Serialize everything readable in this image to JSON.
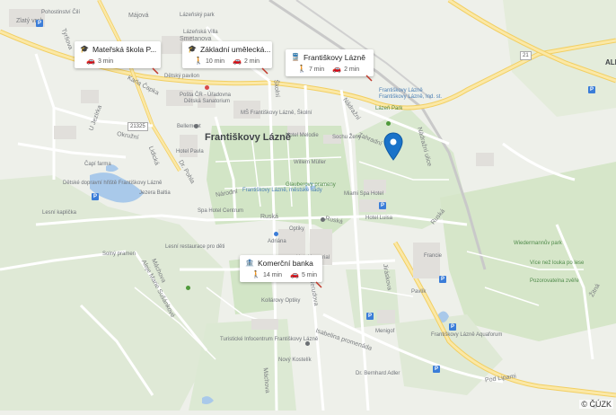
{
  "map": {
    "town_label": "Františkovy Lázně",
    "streets": [
      "Májová",
      "Karla Čapka",
      "Okružní",
      "Lidická",
      "Dr. Pohla",
      "Ruská",
      "Ruská",
      "Ruská",
      "Jiráskova",
      "Nádražní",
      "Zahradní",
      "Nádražní ulice",
      "Máchova",
      "Máchova",
      "Aleje Marie Sušánkové",
      "Isabelina promenáda",
      "Nerudova",
      "Národní",
      "Pod Lipami",
      "Školní",
      "Žitná",
      "U Jezírka",
      "Tyršova",
      "Zlatý vrch",
      "Smetanova"
    ],
    "road_shields": [
      "21325",
      "21"
    ],
    "places": [
      {
        "text": "Pohostinství Čilí"
      },
      {
        "text": "Lázeňský park"
      },
      {
        "text": "Lázeňská Villa"
      },
      {
        "text": "Dětský pavilon"
      },
      {
        "text": "Pošta ČR - Úřadovna"
      },
      {
        "text": "Dětská Sanatorium"
      },
      {
        "text": "Františkovy Lázně"
      },
      {
        "text": "MŠ Františkovy Lázně, Školní"
      },
      {
        "text": "Bellemont"
      },
      {
        "text": "Hotel Melodie"
      },
      {
        "text": "Sochu Ženy"
      },
      {
        "text": "Lázeň Park"
      },
      {
        "text": "Čapí farma"
      },
      {
        "text": "Dětské dopravní hřiště Františkovy Lázně"
      },
      {
        "text": "Hotel Pavla"
      },
      {
        "text": "Spa Hotel Centrum"
      },
      {
        "text": "Františkovy Lázně, městské sady"
      },
      {
        "text": "Willem Müller"
      },
      {
        "text": "Glauberovy prameny"
      },
      {
        "text": "Miami Spa Hotel"
      },
      {
        "text": "Hotel Luisa"
      },
      {
        "text": "Lesní kaplička"
      },
      {
        "text": "Jezera Baltia"
      },
      {
        "text": "Adriána"
      },
      {
        "text": "Optiky"
      },
      {
        "text": "Hotel Imperial"
      },
      {
        "text": "Solný pramen"
      },
      {
        "text": "Lesní restaurace pro děti"
      },
      {
        "text": "Kollárovy Optiky"
      },
      {
        "text": "Menigof"
      },
      {
        "text": "Wiedermannův park"
      },
      {
        "text": "Francie"
      },
      {
        "text": "Pavlík"
      },
      {
        "text": "Více než louka po lese"
      },
      {
        "text": "Pozorovatelna zvěře"
      },
      {
        "text": "Františkovy Lázně Aquaforum"
      },
      {
        "text": "Turistické Infocentrum Františkovy Lázně"
      },
      {
        "text": "Nový Kostelík"
      },
      {
        "text": "Dr. Bernhard Adler"
      },
      {
        "text": "Františkovy Lázně, Ind. st."
      },
      {
        "text": "ALE"
      }
    ]
  },
  "cards": [
    {
      "title": "Mateřská škola P...",
      "icon": "school-icon",
      "rows": [
        {
          "mode": "car-icon",
          "time": "3 min"
        }
      ]
    },
    {
      "title": "Základní umělecká...",
      "icon": "school-icon",
      "rows": [
        {
          "mode": "walk-icon",
          "time": "10 min"
        },
        {
          "mode": "car-icon",
          "time": "2 min"
        }
      ]
    },
    {
      "title": "Františkovy Lázně",
      "icon": "train-icon",
      "rows": [
        {
          "mode": "walk-icon",
          "time": "7 min"
        },
        {
          "mode": "car-icon",
          "time": "2 min"
        }
      ]
    },
    {
      "title": "Komerční banka",
      "icon": "bank-icon",
      "rows": [
        {
          "mode": "walk-icon",
          "time": "14 min"
        },
        {
          "mode": "car-icon",
          "time": "5 min"
        }
      ]
    }
  ],
  "marker": {
    "icon": "location-pin-icon",
    "color": "#1a73c9"
  },
  "attribution": "© ČÚZK",
  "colors": {
    "park": "#cfe3c3",
    "water": "#a9c9ea",
    "road": "#ffffff",
    "major_road": "#f7df8b",
    "background": "#eef0ea"
  }
}
